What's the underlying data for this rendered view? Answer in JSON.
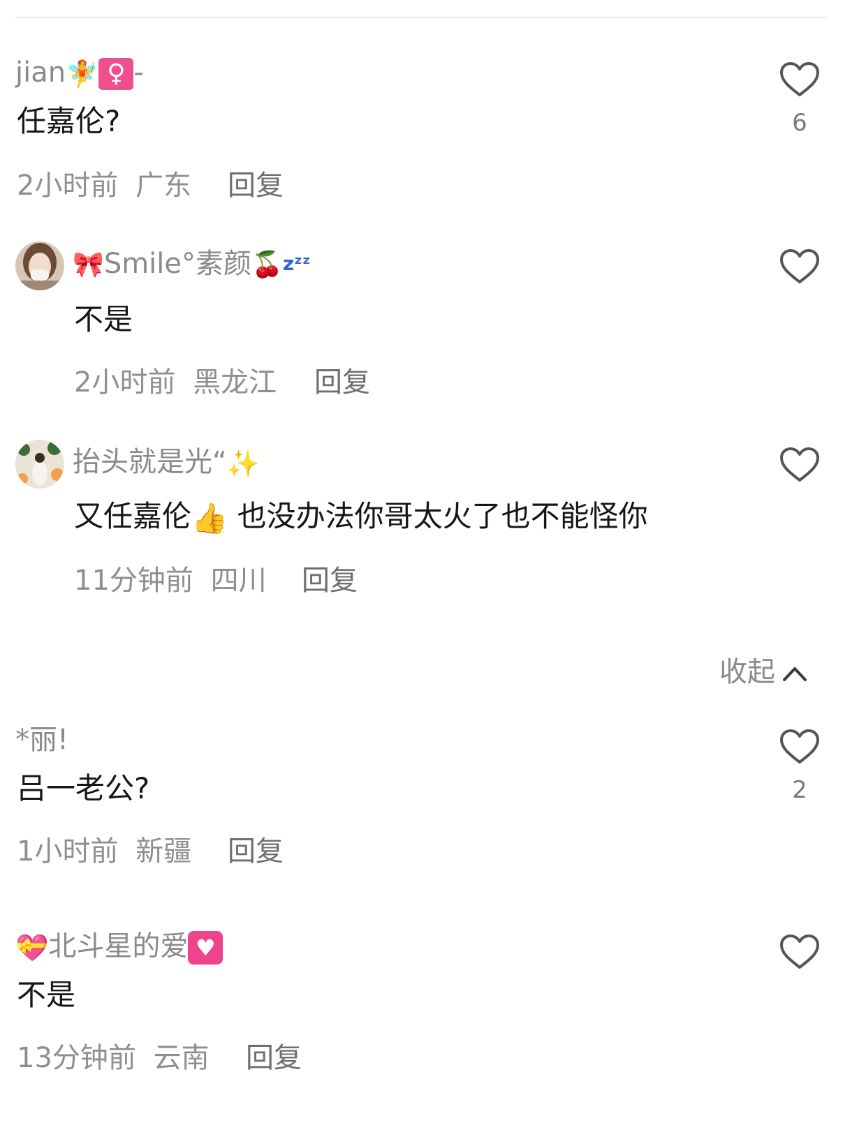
{
  "comments": [
    {
      "username": "jian",
      "username_emoji": "🧚♀-",
      "text": "任嘉伦?",
      "time": "2小时前",
      "region": "广东",
      "reply_label": "回复",
      "likes": "6"
    },
    {
      "username": "Smile°素颜",
      "username_prefix_emoji": "🎀",
      "username_suffix_emoji": "🍒💤",
      "text": "不是",
      "time": "2小时前",
      "region": "黑龙江",
      "reply_label": "回复"
    },
    {
      "username": "抬头就是光“",
      "username_suffix_emoji": "✨",
      "text_a": "又任嘉伦",
      "text_emoji": "👍",
      "text_b": " 也没办法你哥太火了也不能怪你",
      "time": "11分钟前",
      "region": "四川",
      "reply_label": "回复"
    },
    {
      "username": "*丽!",
      "text": "吕一老公?",
      "time": "1小时前",
      "region": "新疆",
      "reply_label": "回复",
      "likes": "2"
    },
    {
      "username_prefix_emoji": "💝",
      "username": "北斗星的爱",
      "username_suffix_emoji": "💟",
      "text": "不是",
      "time": "13分钟前",
      "region": "云南",
      "reply_label": "回复"
    }
  ],
  "collapse_label": "收起",
  "colors": {
    "text": "#161616",
    "muted": "#8a8a8a",
    "reply": "#6e6e6e",
    "heart_stroke": "#555555"
  }
}
